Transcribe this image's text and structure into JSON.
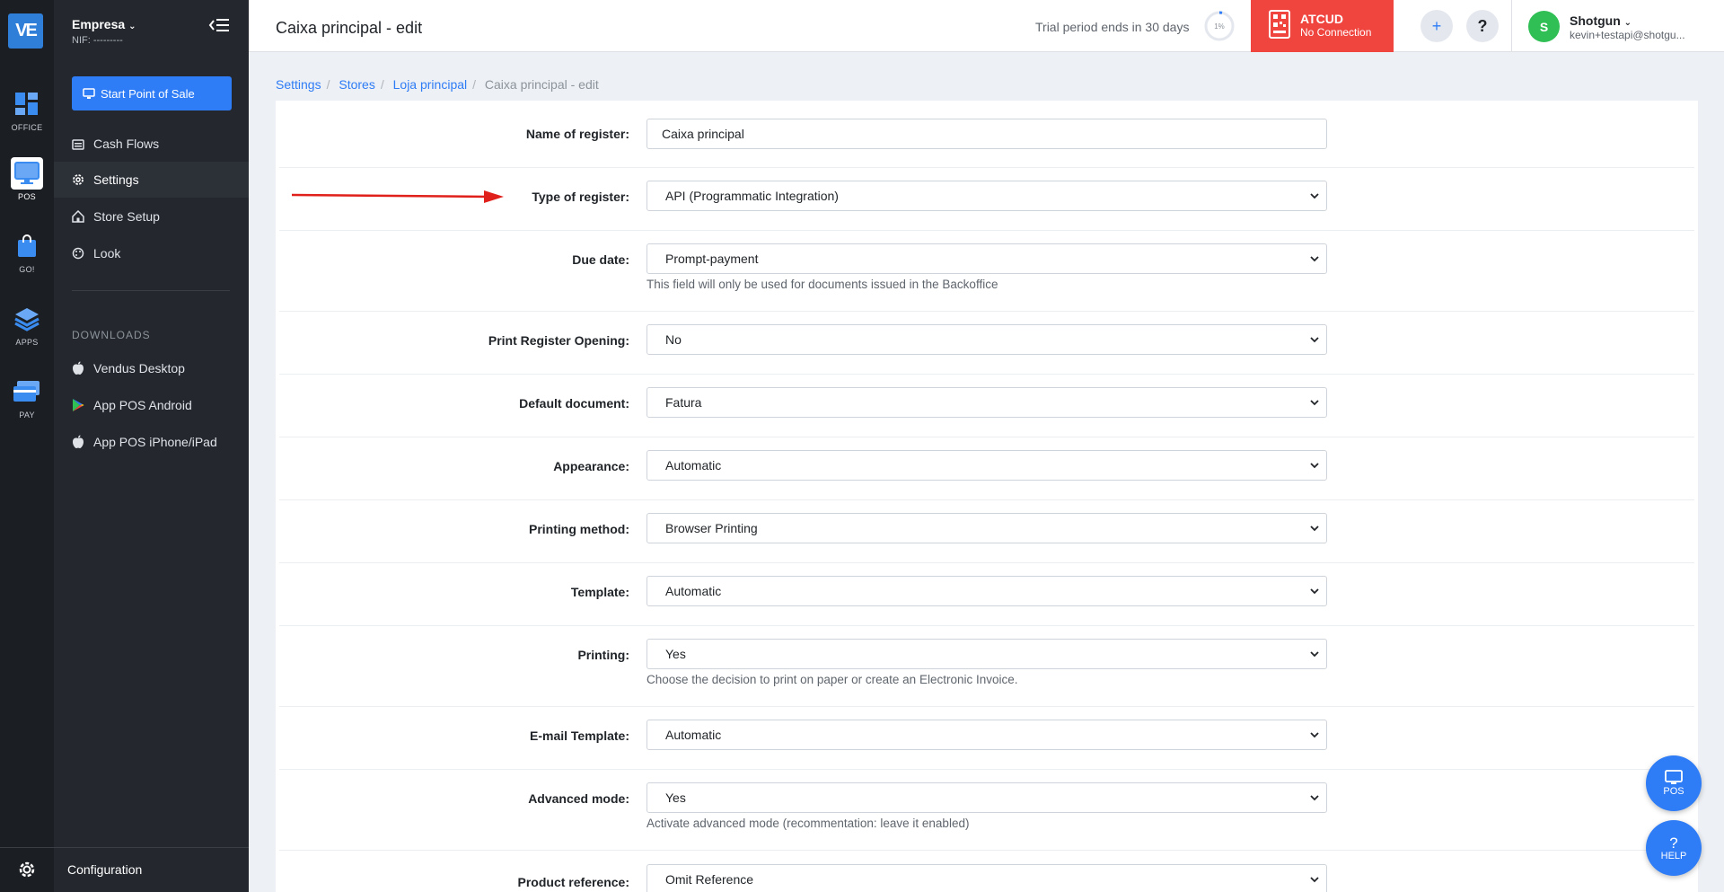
{
  "rail": {
    "logo_text": "VE",
    "items": [
      {
        "label": "OFFICE"
      },
      {
        "label": "POS"
      },
      {
        "label": "GO!"
      },
      {
        "label": "APPS"
      },
      {
        "label": "PAY"
      }
    ]
  },
  "sidebar": {
    "company": "Empresa",
    "nif": "NIF: ---------",
    "start_button": "Start Point of Sale",
    "nav": [
      {
        "label": "Cash Flows"
      },
      {
        "label": "Settings"
      },
      {
        "label": "Store Setup"
      },
      {
        "label": "Look"
      }
    ],
    "downloads_heading": "DOWNLOADS",
    "downloads": [
      {
        "label": "Vendus Desktop"
      },
      {
        "label": "App POS Android"
      },
      {
        "label": "App POS iPhone/iPad"
      }
    ],
    "configuration": "Configuration"
  },
  "header": {
    "title": "Caixa principal - edit",
    "trial_text": "Trial period ends in 30 days",
    "trial_percent": "1%",
    "atcud_title": "ATCUD",
    "atcud_status": "No Connection",
    "user_initial": "S",
    "user_name": "Shotgun",
    "user_email": "kevin+testapi@shotgu..."
  },
  "breadcrumb": {
    "items": [
      "Settings",
      "Stores",
      "Loja principal"
    ],
    "current": "Caixa principal - edit"
  },
  "form": {
    "fields": [
      {
        "label": "Name of register:",
        "value": "Caixa principal",
        "type": "input"
      },
      {
        "label": "Type of register:",
        "value": "API (Programmatic Integration)",
        "type": "select"
      },
      {
        "label": "Due date:",
        "value": "Prompt-payment",
        "type": "select",
        "help": "This field will only be used for documents issued in the Backoffice"
      },
      {
        "label": "Print Register Opening:",
        "value": "No",
        "type": "select"
      },
      {
        "label": "Default document:",
        "value": "Fatura",
        "type": "select"
      },
      {
        "label": "Appearance:",
        "value": "Automatic",
        "type": "select"
      },
      {
        "label": "Printing method:",
        "value": "Browser Printing",
        "type": "select"
      },
      {
        "label": "Template:",
        "value": "Automatic",
        "type": "select"
      },
      {
        "label": "Printing:",
        "value": "Yes",
        "type": "select",
        "help": "Choose the decision to print on paper or create an Electronic Invoice."
      },
      {
        "label": "E-mail Template:",
        "value": "Automatic",
        "type": "select"
      },
      {
        "label": "Advanced mode:",
        "value": "Yes",
        "type": "select",
        "help": "Activate advanced mode (recommentation: leave it enabled)"
      },
      {
        "label": "Product reference:",
        "value": "Omit Reference",
        "type": "select"
      }
    ]
  },
  "fab": {
    "pos_label": "POS",
    "help_label": "HELP"
  },
  "colors": {
    "accent": "#2e7cf6",
    "atcud_bg": "#f0443f",
    "sidebar_bg": "#24282e",
    "rail_bg": "#1b1e23",
    "arrow": "#e0201b"
  }
}
